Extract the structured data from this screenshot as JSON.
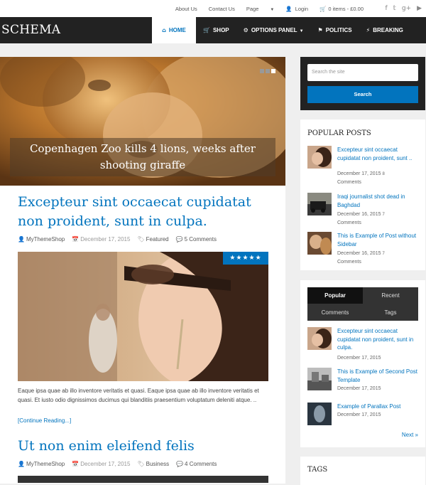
{
  "topbar": {
    "links": [
      "About Us",
      "Contact Us",
      "Page"
    ],
    "login": "Login",
    "cart": "0 items - £0.00",
    "social_icons": [
      "facebook-icon",
      "twitter-icon",
      "google-plus-icon",
      "youtube-icon"
    ]
  },
  "header": {
    "logo": "SCHEMA",
    "nav": [
      {
        "label": "HOME",
        "icon": "home-icon"
      },
      {
        "label": "SHOP",
        "icon": "cart-icon"
      },
      {
        "label": "OPTIONS PANEL",
        "icon": "gears-icon"
      },
      {
        "label": "POLITICS",
        "icon": "flag-icon"
      },
      {
        "label": "BREAKING",
        "icon": "bolt-icon"
      }
    ]
  },
  "slider": {
    "caption": "Copenhagen Zoo kills 4 lions, weeks after shooting giraffe"
  },
  "posts": [
    {
      "title": "Excepteur sint occaecat cupidatat non proident, sunt in culpa.",
      "author": "MyThemeShop",
      "date": "December 17, 2015",
      "category": "Featured",
      "comments": "5 Comments",
      "rating_stars": "★★★★★",
      "excerpt": "Eaque ipsa quae ab illo inventore veritatis et quasi. Eaque ipsa quae ab illo inventore veritatis et quasi. Et iusto odio dignissimos ducimus qui blanditiis praesentium voluptatum deleniti atque. ..",
      "read_more": "[Continue Reading...]"
    },
    {
      "title": "Ut non enim eleifend felis",
      "author": "MyThemeShop",
      "date": "December 17, 2015",
      "category": "Business",
      "comments": "4 Comments"
    }
  ],
  "sidebar": {
    "search_placeholder": "Search the site",
    "search_button": "Search",
    "popular_title": "POPULAR POSTS",
    "popular": [
      {
        "title": "Excepteur sint occaecat cupidatat non proident, sunt ..",
        "date": "December 17, 2015",
        "count": "8",
        "comments": "Comments"
      },
      {
        "title": "Iraqi journalist shot dead in Baghdad",
        "date": "December 16, 2015",
        "count": "7",
        "comments": "Comments"
      },
      {
        "title": "This is Example of Post without Sidebar",
        "date": "December 16, 2015",
        "count": "7",
        "comments": "Comments"
      }
    ],
    "tabs": [
      "Popular",
      "Recent",
      "Comments",
      "Tags"
    ],
    "tab_posts": [
      {
        "title": "Excepteur sint occaecat cupidatat non proident, sunt in culpa.",
        "date": "December 17, 2015"
      },
      {
        "title": "This is Example of Second Post Template",
        "date": "December 17, 2015"
      },
      {
        "title": "Example of Parallax Post",
        "date": "December 17, 2015"
      }
    ],
    "next": "Next »",
    "tags_title": "TAGS"
  }
}
